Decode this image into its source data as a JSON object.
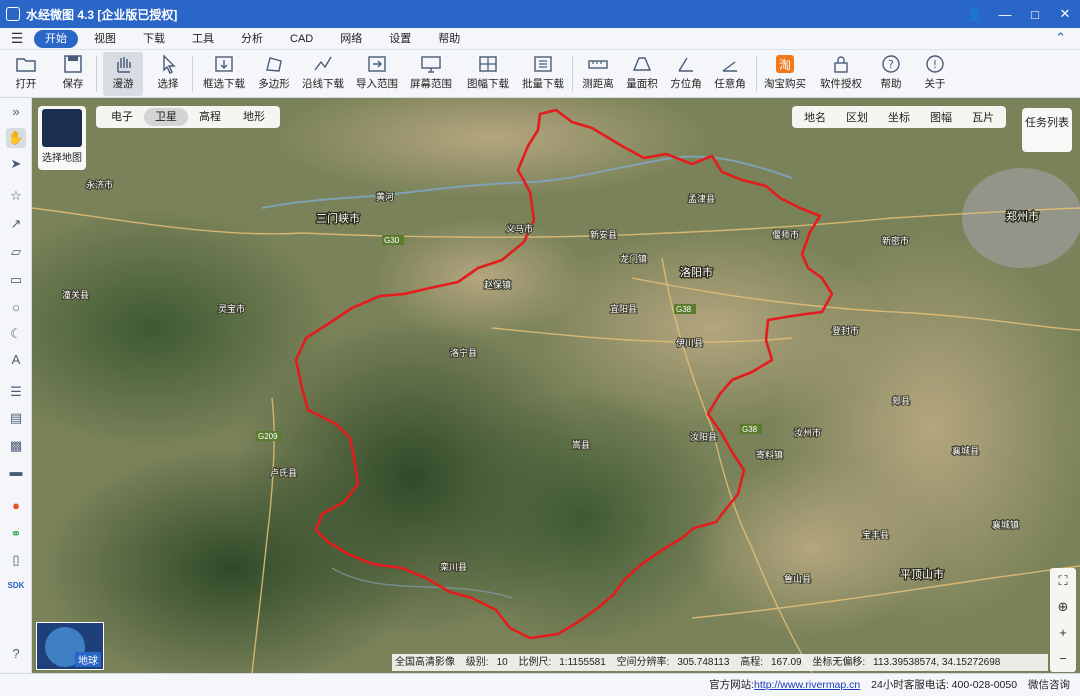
{
  "app": {
    "title": "水经微图 4.3 [企业版已授权]"
  },
  "menu": [
    "开始",
    "视图",
    "下载",
    "工具",
    "分析",
    "CAD",
    "网络",
    "设置",
    "帮助"
  ],
  "toolbar": [
    "打开",
    "保存",
    "漫游",
    "选择",
    "框选下载",
    "多边形",
    "沿线下载",
    "导入范围",
    "屏幕范围",
    "图幅下载",
    "批量下载",
    "测距离",
    "量面积",
    "方位角",
    "任意角",
    "淘宝购买",
    "软件授权",
    "帮助",
    "关于"
  ],
  "map": {
    "selector": "选择地图",
    "tabs": [
      "电子",
      "卫星",
      "高程",
      "地形"
    ],
    "active_tab": "卫星",
    "right_tabs": [
      "地名",
      "区划",
      "坐标",
      "图幅",
      "瓦片"
    ],
    "task_list": "任务列表",
    "globe": "地球",
    "cities": [
      "三门峡市",
      "洛阳市",
      "郑州市",
      "平顶山市",
      "登封市",
      "汝阳县",
      "嵩县",
      "栾川县",
      "洛宁县",
      "宜阳县",
      "伊川县",
      "新安县",
      "孟津县",
      "偃师市",
      "汝州市",
      "宝丰县",
      "鲁山县",
      "灵宝市",
      "卢氏县",
      "汝阳县"
    ],
    "roads": [
      "G30",
      "G38",
      "G209"
    ],
    "river": "黄河"
  },
  "status": {
    "imagery": "全国高清影像",
    "level_label": "级别:",
    "level": "10",
    "scale_label": "比例尺:",
    "scale": "1:1155581",
    "res_label": "空间分辨率:",
    "resolution": "305.748113",
    "elev_label": "高程:",
    "elevation": "167.09",
    "coord_label": "坐标无偏移:",
    "coords": "113.39538574, 34.15272698"
  },
  "footer": {
    "site_label": "官方网站:",
    "site": "http://www.rivermap.cn",
    "hotline": "24小时客服电话: 400-028-0050",
    "wechat": "微信咨询"
  }
}
